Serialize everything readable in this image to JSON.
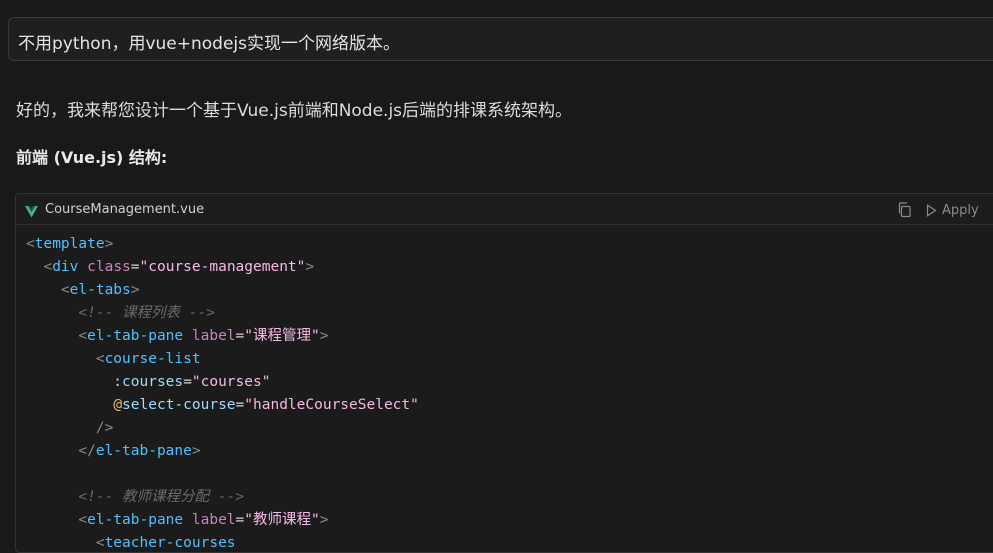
{
  "user_message": "不用python，用vue+nodejs实现一个网络版本。",
  "assistant": {
    "intro": "好的，我来帮您设计一个基于Vue.js前端和Node.js后端的排课系统架构。",
    "heading": "前端 (Vue.js) 结构:"
  },
  "code_block": {
    "filename": "CourseManagement.vue",
    "language_icon": "vue-logo-icon",
    "apply_label": "Apply",
    "copy_icon": "copy-icon",
    "apply_icon": "play-triangle-icon",
    "lines": [
      [
        {
          "t": "<",
          "c": "punct"
        },
        {
          "t": "template",
          "c": "tag"
        },
        {
          "t": ">",
          "c": "punct"
        }
      ],
      [
        {
          "t": "  <",
          "c": "punct"
        },
        {
          "t": "div",
          "c": "tag"
        },
        {
          "t": " ",
          "c": "plain"
        },
        {
          "t": "class",
          "c": "attr"
        },
        {
          "t": "=",
          "c": "plain"
        },
        {
          "t": "\"course-management\"",
          "c": "str"
        },
        {
          "t": ">",
          "c": "punct"
        }
      ],
      [
        {
          "t": "    <",
          "c": "punct"
        },
        {
          "t": "el-tabs",
          "c": "tag"
        },
        {
          "t": ">",
          "c": "punct"
        }
      ],
      [
        {
          "t": "      <!-- 课程列表 -->",
          "c": "comment"
        }
      ],
      [
        {
          "t": "      <",
          "c": "punct"
        },
        {
          "t": "el-tab-pane",
          "c": "tag"
        },
        {
          "t": " ",
          "c": "plain"
        },
        {
          "t": "label",
          "c": "attr"
        },
        {
          "t": "=",
          "c": "plain"
        },
        {
          "t": "\"课程管理\"",
          "c": "str"
        },
        {
          "t": ">",
          "c": "punct"
        }
      ],
      [
        {
          "t": "        <",
          "c": "punct"
        },
        {
          "t": "course-list",
          "c": "tag"
        }
      ],
      [
        {
          "t": "          :",
          "c": "plain"
        },
        {
          "t": "courses",
          "c": "vattr"
        },
        {
          "t": "=",
          "c": "plain"
        },
        {
          "t": "\"courses\"",
          "c": "str"
        }
      ],
      [
        {
          "t": "          ",
          "c": "plain"
        },
        {
          "t": "@",
          "c": "at"
        },
        {
          "t": "select-course",
          "c": "vattr"
        },
        {
          "t": "=",
          "c": "plain"
        },
        {
          "t": "\"handleCourseSelect\"",
          "c": "str"
        }
      ],
      [
        {
          "t": "        />",
          "c": "punct"
        }
      ],
      [
        {
          "t": "      </",
          "c": "punct"
        },
        {
          "t": "el-tab-pane",
          "c": "tag"
        },
        {
          "t": ">",
          "c": "punct"
        }
      ],
      [
        {
          "t": "",
          "c": "plain"
        }
      ],
      [
        {
          "t": "      <!-- 教师课程分配 -->",
          "c": "comment"
        }
      ],
      [
        {
          "t": "      <",
          "c": "punct"
        },
        {
          "t": "el-tab-pane",
          "c": "tag"
        },
        {
          "t": " ",
          "c": "plain"
        },
        {
          "t": "label",
          "c": "attr"
        },
        {
          "t": "=",
          "c": "plain"
        },
        {
          "t": "\"教师课程\"",
          "c": "str"
        },
        {
          "t": ">",
          "c": "punct"
        }
      ],
      [
        {
          "t": "        <",
          "c": "punct"
        },
        {
          "t": "teacher-courses",
          "c": "tag"
        }
      ]
    ]
  }
}
